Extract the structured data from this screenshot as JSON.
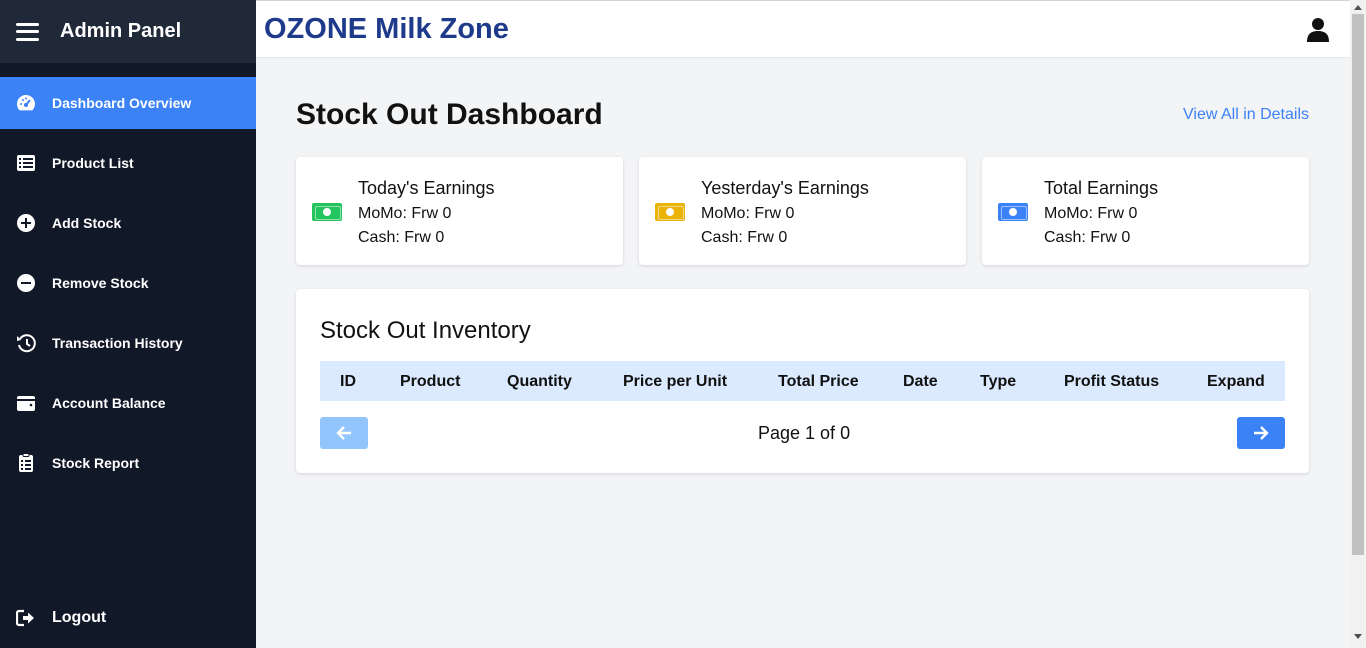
{
  "sidebar": {
    "title": "Admin Panel",
    "items": [
      {
        "label": "Dashboard Overview",
        "icon": "gauge-icon",
        "active": true
      },
      {
        "label": "Product List",
        "icon": "list-icon"
      },
      {
        "label": "Add Stock",
        "icon": "plus-circle-icon"
      },
      {
        "label": "Remove Stock",
        "icon": "minus-circle-icon"
      },
      {
        "label": "Transaction History",
        "icon": "history-icon"
      },
      {
        "label": "Account Balance",
        "icon": "wallet-icon"
      },
      {
        "label": "Stock Report",
        "icon": "clipboard-icon"
      }
    ],
    "logout": "Logout"
  },
  "header": {
    "brand": "OZONE Milk Zone",
    "user_icon": "user-icon"
  },
  "main": {
    "title": "Stock Out Dashboard",
    "view_all": "View All in Details",
    "cards": [
      {
        "title": "Today's Earnings",
        "momo": "MoMo: Frw 0",
        "cash": "Cash: Frw 0",
        "color": "#22c55e"
      },
      {
        "title": "Yesterday's Earnings",
        "momo": "MoMo: Frw 0",
        "cash": "Cash: Frw 0",
        "color": "#eab308"
      },
      {
        "title": "Total Earnings",
        "momo": "MoMo: Frw 0",
        "cash": "Cash: Frw 0",
        "color": "#3b82f6"
      }
    ],
    "inventory": {
      "title": "Stock Out Inventory",
      "columns": [
        "ID",
        "Product",
        "Quantity",
        "Price per Unit",
        "Total Price",
        "Date",
        "Type",
        "Profit Status",
        "Expand"
      ],
      "page_text": "Page 1 of 0"
    }
  },
  "colors": {
    "sidebar_bg": "#111827",
    "accent": "#3b82f6",
    "brand": "#1e3a8a"
  }
}
